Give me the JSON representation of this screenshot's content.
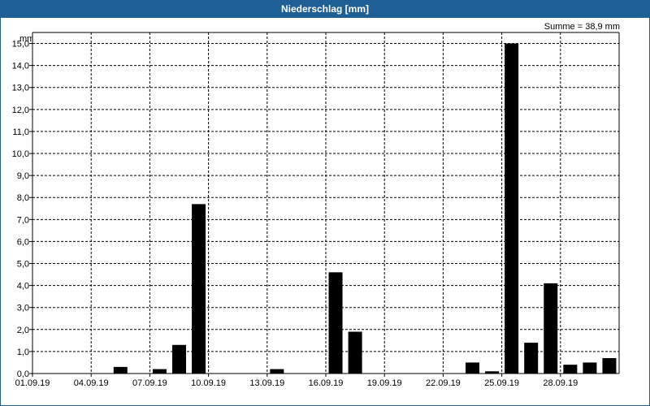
{
  "window": {
    "title": "Niederschlag [mm]",
    "summary": "Summe = 38,9 mm"
  },
  "chart_data": {
    "type": "bar",
    "title": "Niederschlag [mm]",
    "ylabel": "mm",
    "xlabel": "",
    "annotation": "Summe = 38,9 mm",
    "ylim": [
      0,
      15.5
    ],
    "y_ticks": [
      "0,0",
      "1,0",
      "2,0",
      "3,0",
      "4,0",
      "5,0",
      "6,0",
      "7,0",
      "8,0",
      "9,0",
      "10,0",
      "11,0",
      "12,0",
      "13,0",
      "14,0",
      "15,0"
    ],
    "x_ticks": [
      "01.09.19",
      "04.09.19",
      "07.09.19",
      "10.09.19",
      "13.09.19",
      "16.09.19",
      "19.09.19",
      "22.09.19",
      "25.09.19",
      "28.09.19"
    ],
    "grid": true,
    "categories": [
      "01.09.19",
      "02.09.19",
      "03.09.19",
      "04.09.19",
      "05.09.19",
      "06.09.19",
      "07.09.19",
      "08.09.19",
      "09.09.19",
      "10.09.19",
      "11.09.19",
      "12.09.19",
      "13.09.19",
      "14.09.19",
      "15.09.19",
      "16.09.19",
      "17.09.19",
      "18.09.19",
      "19.09.19",
      "20.09.19",
      "21.09.19",
      "22.09.19",
      "23.09.19",
      "24.09.19",
      "25.09.19",
      "26.09.19",
      "27.09.19",
      "28.09.19",
      "29.09.19",
      "30.09.19"
    ],
    "values": [
      0,
      0,
      0,
      0,
      0.3,
      0,
      0.2,
      1.3,
      7.7,
      0,
      0,
      0,
      0.2,
      0,
      0,
      4.6,
      1.9,
      0,
      0,
      0,
      0,
      0,
      0.5,
      0.1,
      15.0,
      1.4,
      4.1,
      0.4,
      0.5,
      0.7
    ],
    "bar_color": "#000000"
  }
}
